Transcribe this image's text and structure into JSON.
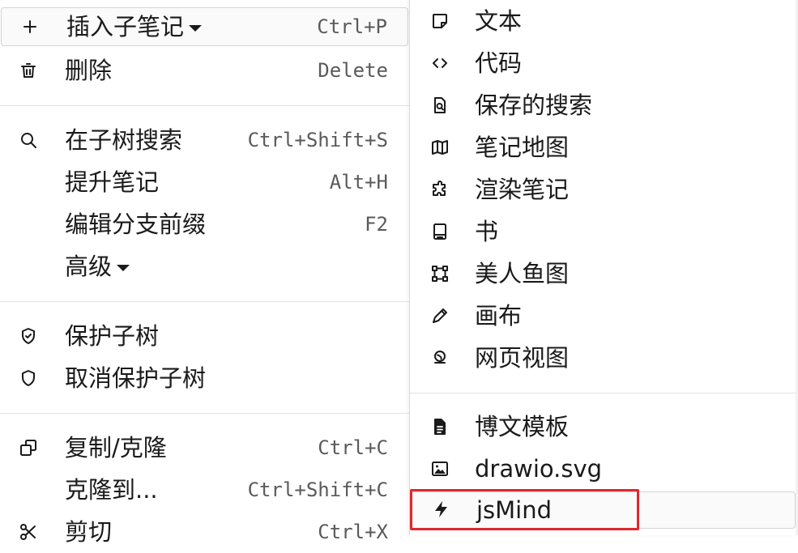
{
  "main_menu": {
    "items": [
      {
        "label": "插入子笔记",
        "shortcut": "Ctrl+P",
        "icon": "plus-icon"
      },
      {
        "label": "删除",
        "shortcut": "Delete",
        "icon": "trash-icon"
      },
      {
        "label": "在子树搜索",
        "shortcut": "Ctrl+Shift+S",
        "icon": "search-icon"
      },
      {
        "label": "提升笔记",
        "shortcut": "Alt+H"
      },
      {
        "label": "编辑分支前缀",
        "shortcut": "F2"
      },
      {
        "label": "高级"
      },
      {
        "label": "保护子树",
        "icon": "shield-check-icon"
      },
      {
        "label": "取消保护子树",
        "icon": "shield-icon"
      },
      {
        "label": "复制/克隆",
        "shortcut": "Ctrl+C",
        "icon": "copy-icon"
      },
      {
        "label": "克隆到...",
        "shortcut": "Ctrl+Shift+C"
      },
      {
        "label": "剪切",
        "shortcut": "Ctrl+X",
        "icon": "scissors-icon"
      }
    ]
  },
  "submenu": {
    "items": [
      {
        "label": "文本",
        "icon": "note-icon"
      },
      {
        "label": "代码",
        "icon": "code-icon"
      },
      {
        "label": "保存的搜索",
        "icon": "saved-search-icon"
      },
      {
        "label": "笔记地图",
        "icon": "map-icon"
      },
      {
        "label": "渲染笔记",
        "icon": "puzzle-icon"
      },
      {
        "label": "书",
        "icon": "book-icon"
      },
      {
        "label": "美人鱼图",
        "icon": "diagram-icon"
      },
      {
        "label": "画布",
        "icon": "pen-icon"
      },
      {
        "label": "网页视图",
        "icon": "globe-icon"
      },
      {
        "label": "博文模板",
        "icon": "file-text-icon"
      },
      {
        "label": "drawio.svg",
        "icon": "image-icon"
      },
      {
        "label": "jsMind",
        "icon": "bolt-icon"
      }
    ]
  },
  "colors": {
    "highlight_box": "#e0272d",
    "text": "#1a1a1a",
    "shortcut": "#5a5a5a"
  }
}
